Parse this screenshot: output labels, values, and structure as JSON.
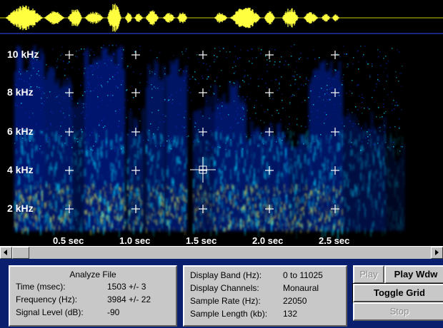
{
  "spectrogram": {
    "frequency_labels": [
      "10 kHz",
      "8 kHz",
      "6 kHz",
      "4 kHz",
      "2 kHz"
    ],
    "time_labels": [
      "0.5 sec",
      "1.0 sec",
      "1.5 sec",
      "2.0 sec",
      "2.5 sec"
    ]
  },
  "analyze_panel": {
    "title": "Analyze File",
    "rows": [
      {
        "label": "Time (msec):",
        "value": "1503 +/- 3"
      },
      {
        "label": "Frequency (Hz):",
        "value": "3984 +/- 22"
      },
      {
        "label": "Signal Level (dB):",
        "value": "-90"
      }
    ]
  },
  "display_panel": {
    "rows": [
      {
        "label": "Display Band (Hz):",
        "value": "0 to 11025"
      },
      {
        "label": "Display Channels:",
        "value": "Monaural"
      },
      {
        "label": "Sample Rate (Hz):",
        "value": "22050"
      },
      {
        "label": "Sample Length (kb):",
        "value": "132"
      }
    ]
  },
  "buttons": {
    "play": "Play",
    "play_window": "Play Wdw",
    "toggle_grid": "Toggle Grid",
    "stop": "Stop"
  },
  "colors": {
    "waveform": "#ffff40",
    "baseline": "#3050ff",
    "panel_bg": "#0a1f6e",
    "spectro_low": "#0a2cc8",
    "spectro_mid": "#00d8ff",
    "spectro_high": "#ffff50"
  }
}
